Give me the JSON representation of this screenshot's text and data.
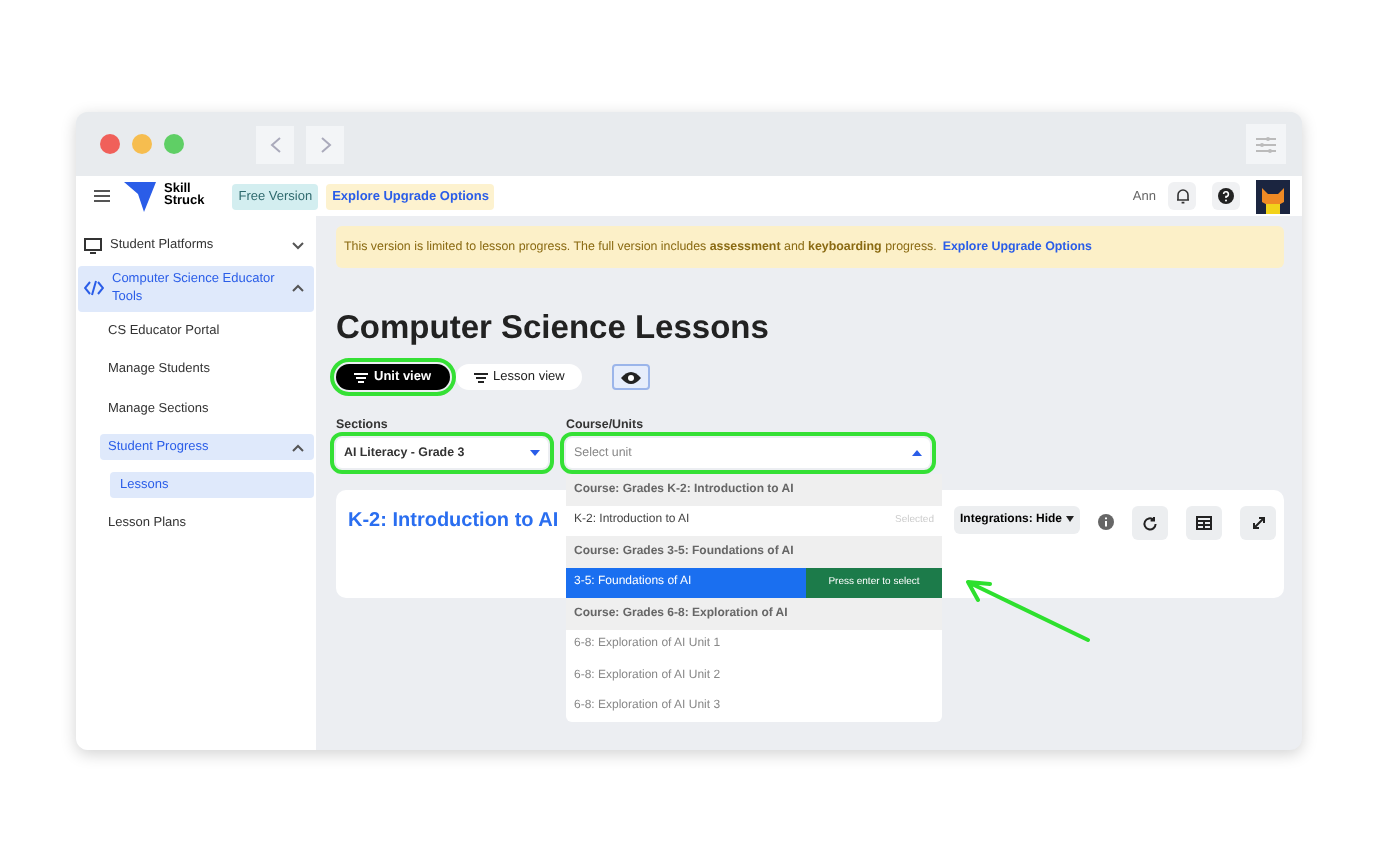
{
  "header": {
    "brand_lines": [
      "Skill",
      "Struck"
    ],
    "badges": [
      {
        "label": "Free Version",
        "kind": "plan"
      },
      {
        "label": "Explore Upgrade Options",
        "kind": "upgrade"
      }
    ],
    "user_name": "Ann"
  },
  "sidebar": {
    "items": [
      {
        "label": "Student Platforms",
        "expanded": false,
        "selected": false
      },
      {
        "label": "Computer Science Educator Tools",
        "expanded": true,
        "selected": false,
        "children": [
          {
            "label": "CS Educator Portal",
            "selected": false
          },
          {
            "label": "Manage Students",
            "selected": false
          },
          {
            "label": "Manage Sections",
            "selected": false
          },
          {
            "label": "Student Progress",
            "expanded": true,
            "selected": false,
            "children": [
              {
                "label": "Lessons",
                "selected": true
              }
            ]
          },
          {
            "label": "Lesson Plans",
            "selected": false
          }
        ]
      }
    ]
  },
  "banner": {
    "text": "This version is limited to lesson progress. The full version includes **assessment** and **keyboarding** progress.",
    "link": "Explore Upgrade Options"
  },
  "page_title": "Computer Science Lessons",
  "view_tabs": [
    {
      "label": "Unit view",
      "selected": true,
      "highlighted": true
    },
    {
      "label": "Lesson view",
      "selected": false,
      "highlighted": false
    }
  ],
  "filters": {
    "sections": {
      "label": "Sections",
      "value": "AI Literacy - Grade 3",
      "highlighted": true
    },
    "course_units": {
      "label": "Course/Units",
      "placeholder": "Select unit",
      "highlighted": true,
      "open": true,
      "options": [
        {
          "kind": "group",
          "label": "Course: Grades K-2: Introduction to AI"
        },
        {
          "kind": "option",
          "label": "K-2: Introduction to AI",
          "selected": true,
          "focused": false,
          "hint": "Selected"
        },
        {
          "kind": "group",
          "label": "Course: Grades 3-5: Foundations of AI"
        },
        {
          "kind": "option",
          "label": "3-5: Foundations of AI",
          "selected": false,
          "focused": true,
          "hint": "Press enter to select"
        },
        {
          "kind": "group",
          "label": "Course: Grades 6-8: Exploration of AI"
        },
        {
          "kind": "option",
          "label": "6-8: Exploration of AI Unit 1",
          "selected": false,
          "focused": false
        },
        {
          "kind": "option",
          "label": "6-8: Exploration of AI Unit 2",
          "selected": false,
          "focused": false
        },
        {
          "kind": "option",
          "label": "6-8: Exploration of AI Unit 3",
          "selected": false,
          "focused": false
        }
      ]
    }
  },
  "unit_card": {
    "title": "K-2: Introduction to AI",
    "integrations": "Integrations: Hide"
  }
}
